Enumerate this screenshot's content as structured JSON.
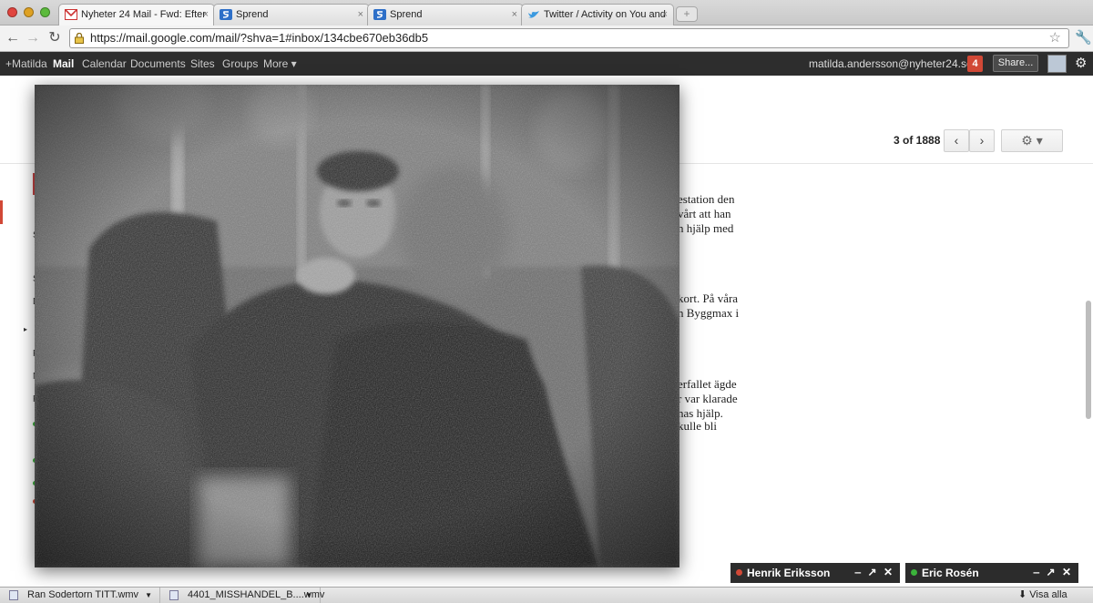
{
  "browser": {
    "tabs": [
      {
        "title": "Nyheter 24 Mail - Fwd: Efter",
        "favicon": "gmail-icon"
      },
      {
        "title": "Sprend",
        "favicon": "sprend-icon"
      },
      {
        "title": "Sprend",
        "favicon": "sprend-icon"
      },
      {
        "title": "Twitter / Activity on You and",
        "favicon": "twitter-icon"
      }
    ],
    "close_glyph": "×",
    "url": "https://mail.google.com/mail/?shva=1#inbox/134cbe670eb36db5",
    "star_glyph": "☆"
  },
  "gbar": {
    "items": [
      "+Matilda",
      "Mail",
      "Calendar",
      "Documents",
      "Sites",
      "Groups",
      "More ▾"
    ],
    "email": "matilda.andersson@nyheter24.se",
    "notifications": "4",
    "share_label": "Share..."
  },
  "mail": {
    "counter": "3 of 1888",
    "prev_glyph": "‹",
    "next_glyph": "›",
    "settings_glyph": "⚙ ▾",
    "body_lines": [
      "estation den",
      "vårt att han",
      "n hjälp med",
      "kort. På våra",
      "n Byggmax i",
      "erfallet ägde",
      "r var klarade",
      "nas hjälp.",
      "kulle bli"
    ],
    "left_letters": [
      "S",
      "S",
      "D",
      "P",
      "N",
      "F"
    ]
  },
  "chats": [
    {
      "name": "Henrik Eriksson",
      "status_color": "#d14836"
    },
    {
      "name": "Eric Rosén",
      "status_color": "#3bb33b"
    }
  ],
  "chat_controls": "‒ ↗ ✕",
  "downloads": {
    "items": [
      "Ran Sodertorn TITT.wmv",
      "4401_MISSHANDEL_B....wmv"
    ],
    "show_all": "⬇ Visa alla"
  }
}
